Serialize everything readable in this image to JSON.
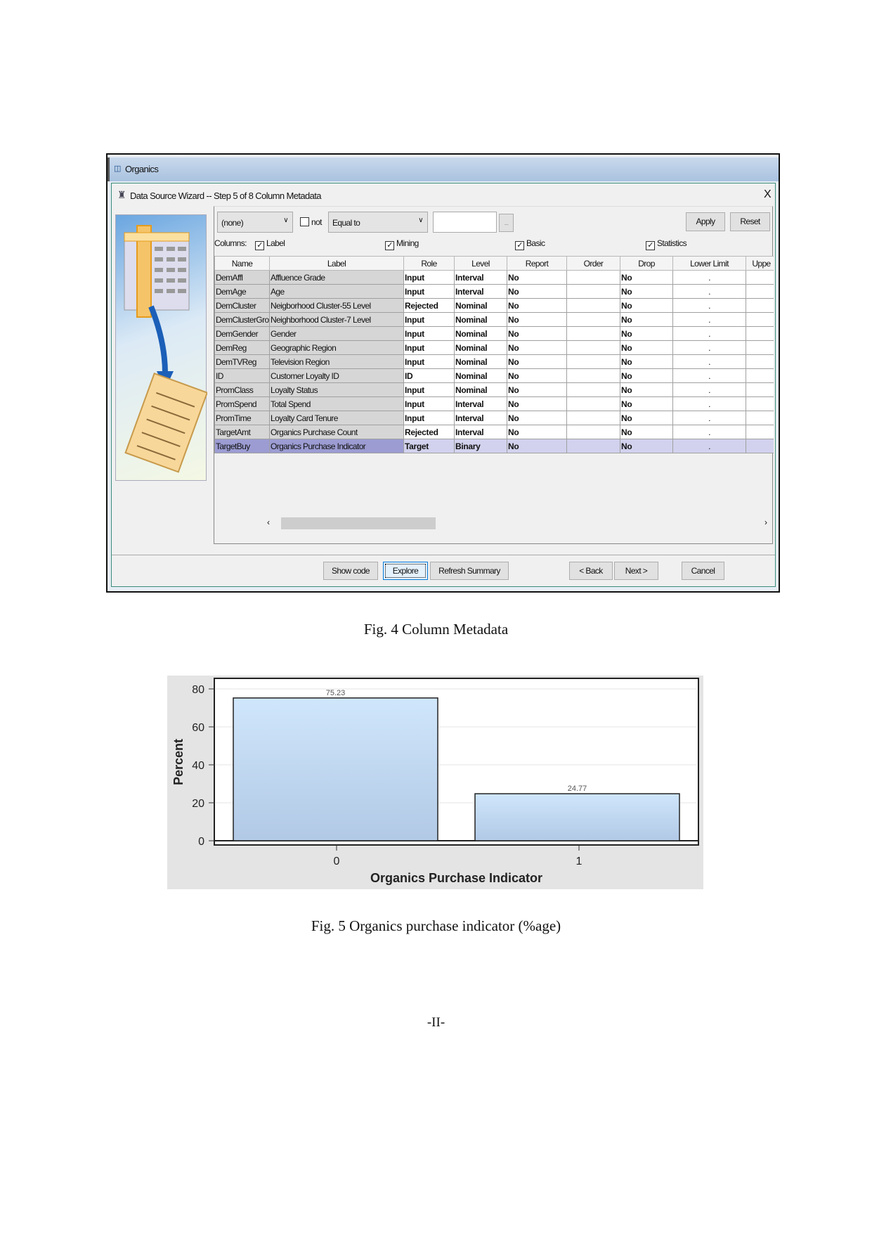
{
  "window": {
    "title": "Organics",
    "icon": "organics-node-icon"
  },
  "wizard": {
    "title": "Data Source Wizard  -- Step 5 of 8  Column Metadata",
    "close": "X",
    "icon": "wizard-icon"
  },
  "filter": {
    "column_select": "(none)",
    "not_label": "not",
    "not_checked": false,
    "operator": "Equal to",
    "value": "",
    "ellipsis": "...",
    "apply": "Apply",
    "reset": "Reset"
  },
  "columns": {
    "label": "Columns:",
    "toggles": [
      {
        "label": "Label",
        "checked": true
      },
      {
        "label": "Mining",
        "checked": true
      },
      {
        "label": "Basic",
        "checked": true
      },
      {
        "label": "Statistics",
        "checked": true
      }
    ]
  },
  "table": {
    "headers": [
      "Name",
      "Label",
      "Role",
      "Level",
      "Report",
      "Order",
      "Drop",
      "Lower Limit",
      "Uppe"
    ],
    "rows": [
      [
        "DemAffl",
        "Affluence Grade",
        "Input",
        "Interval",
        "No",
        "",
        "No",
        "."
      ],
      [
        "DemAge",
        "Age",
        "Input",
        "Interval",
        "No",
        "",
        "No",
        "."
      ],
      [
        "DemCluster",
        "Neigborhood Cluster-55 Level",
        "Rejected",
        "Nominal",
        "No",
        "",
        "No",
        "."
      ],
      [
        "DemClusterGroup",
        "Neighborhood Cluster-7 Level",
        "Input",
        "Nominal",
        "No",
        "",
        "No",
        "."
      ],
      [
        "DemGender",
        "Gender",
        "Input",
        "Nominal",
        "No",
        "",
        "No",
        "."
      ],
      [
        "DemReg",
        "Geographic Region",
        "Input",
        "Nominal",
        "No",
        "",
        "No",
        "."
      ],
      [
        "DemTVReg",
        "Television Region",
        "Input",
        "Nominal",
        "No",
        "",
        "No",
        "."
      ],
      [
        "ID",
        "Customer Loyalty ID",
        "ID",
        "Nominal",
        "No",
        "",
        "No",
        "."
      ],
      [
        "PromClass",
        "Loyalty Status",
        "Input",
        "Nominal",
        "No",
        "",
        "No",
        "."
      ],
      [
        "PromSpend",
        "Total Spend",
        "Input",
        "Interval",
        "No",
        "",
        "No",
        "."
      ],
      [
        "PromTime",
        "Loyalty Card Tenure",
        "Input",
        "Interval",
        "No",
        "",
        "No",
        "."
      ],
      [
        "TargetAmt",
        "Organics Purchase Count",
        "Rejected",
        "Interval",
        "No",
        "",
        "No",
        "."
      ],
      [
        "TargetBuy",
        "Organics Purchase Indicator",
        "Target",
        "Binary",
        "No",
        "",
        "No",
        "."
      ]
    ],
    "selected_row": 12
  },
  "buttons": {
    "show_code": "Show code",
    "explore": "Explore",
    "refresh": "Refresh Summary",
    "back": "< Back",
    "next": "Next >",
    "cancel": "Cancel"
  },
  "captions": {
    "fig4": "Fig. 4 Column Metadata",
    "fig5": "Fig. 5 Organics purchase indicator (%age)"
  },
  "page_number": "-II-",
  "chart_data": {
    "type": "bar",
    "categories": [
      "0",
      "1"
    ],
    "values": [
      75.23,
      24.77
    ],
    "data_labels": [
      "75.23",
      "24.77"
    ],
    "xlabel": "Organics Purchase Indicator",
    "ylabel": "Percent",
    "ylim": [
      0,
      85
    ],
    "yticks": [
      "0",
      "20",
      "40",
      "60",
      "80"
    ],
    "grid": true,
    "colors": {
      "bar_top": "#cfe6fb",
      "bar_bottom": "#b2c9e6",
      "background": "#e4e4e4"
    }
  }
}
